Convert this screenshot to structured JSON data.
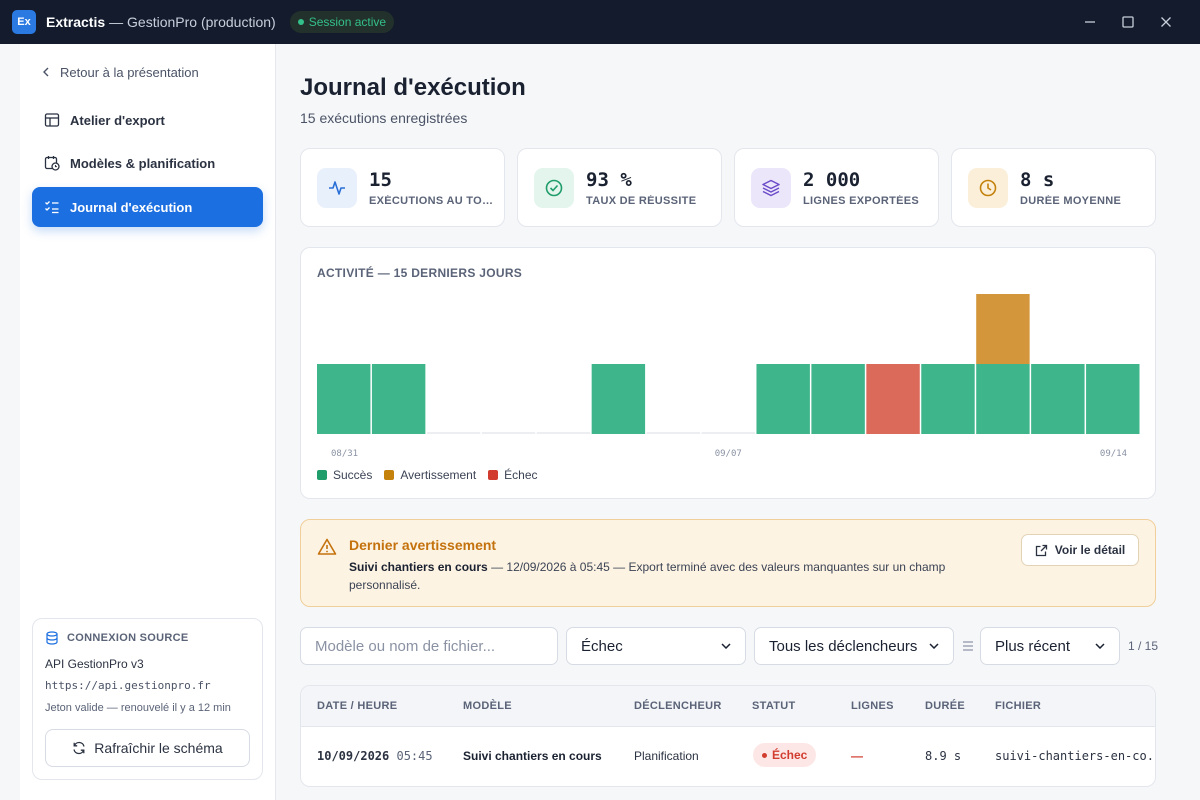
{
  "titlebar": {
    "app_name": "Extractis",
    "app_logo": "Ex",
    "app_context": "— GestionPro (production)",
    "session_badge": "Session active"
  },
  "sidebar": {
    "back_link": "Retour à la présentation",
    "items": [
      {
        "label": "Atelier d'export",
        "icon": "table-icon",
        "active": false
      },
      {
        "label": "Modèles & planification",
        "icon": "calendar-clock-icon",
        "active": false
      },
      {
        "label": "Journal d'exécution",
        "icon": "checklist-icon",
        "active": true
      }
    ],
    "connection": {
      "title": "CONNEXION SOURCE",
      "name": "API GestionPro v3",
      "url": "https://api.gestionpro.fr",
      "token": "Jeton valide — renouvelé il y a 12 min",
      "refresh_label": "Rafraîchir le schéma"
    }
  },
  "page": {
    "title": "Journal d'exécution",
    "subtitle": "15 exécutions enregistrées"
  },
  "stats": [
    {
      "value": "15",
      "label": "EXÉCUTIONS AU TOTAL",
      "icon": "activity-icon",
      "color": "#2a6fd6",
      "bg": "#e8f0fc"
    },
    {
      "value": "93 %",
      "label": "TAUX DE RÉUSSITE",
      "icon": "check-circle-icon",
      "color": "#1f9d6a",
      "bg": "#e3f5ec"
    },
    {
      "value": "2 000",
      "label": "LIGNES EXPORTÉES",
      "icon": "layers-icon",
      "color": "#6b4bc8",
      "bg": "#ece6fb"
    },
    {
      "value": "8 s",
      "label": "DURÉE MOYENNE",
      "icon": "clock-icon",
      "color": "#c4820d",
      "bg": "#fcefd9"
    }
  ],
  "chart_data": {
    "type": "bar",
    "title": "ACTIVITÉ — 15 DERNIERS JOURS",
    "categories": [
      "08/31",
      "09/01",
      "09/02",
      "09/03",
      "09/04",
      "09/05",
      "09/06",
      "09/07",
      "09/08",
      "09/09",
      "09/10",
      "09/11",
      "09/12",
      "09/13",
      "09/14"
    ],
    "tick_labels": [
      "08/31",
      "09/07",
      "09/14"
    ],
    "series": [
      {
        "name": "Succès",
        "color": "#3fb58b",
        "values": [
          1,
          1,
          0,
          0,
          0,
          1,
          0,
          0,
          1,
          1,
          0,
          1,
          1,
          1,
          1
        ]
      },
      {
        "name": "Avertissement",
        "color": "#d4963a",
        "values": [
          0,
          0,
          0,
          0,
          0,
          0,
          0,
          0,
          0,
          0,
          0,
          0,
          1,
          0,
          0
        ]
      },
      {
        "name": "Échec",
        "color": "#dc6a5a",
        "values": [
          0,
          0,
          0,
          0,
          0,
          0,
          0,
          0,
          0,
          0,
          1,
          0,
          0,
          0,
          0
        ]
      }
    ],
    "ylim": [
      0,
      2
    ],
    "stacked": true,
    "legend": "bottom-left",
    "legend_colors": [
      "#1f9d6a",
      "#c4820d",
      "#d13c2f"
    ]
  },
  "warning": {
    "title": "Dernier avertissement",
    "model": "Suivi chantiers en cours",
    "message": "— 12/09/2026 à 05:45 — Export terminé avec des valeurs manquantes sur un champ personnalisé.",
    "detail_label": "Voir le détail"
  },
  "filters": {
    "search_placeholder": "Modèle ou nom de fichier...",
    "status_value": "Échec",
    "trigger_value": "Tous les déclencheurs",
    "sort_value": "Plus récent",
    "page_count": "1 / 15"
  },
  "table": {
    "columns": [
      "DATE / HEURE",
      "MODÈLE",
      "DÉCLENCHEUR",
      "STATUT",
      "LIGNES",
      "DURÉE",
      "FICHIER"
    ],
    "rows": [
      {
        "date": "10/09/2026",
        "time": "05:45",
        "model": "Suivi chantiers en cours",
        "trigger": "Planification",
        "status": "Échec",
        "lines": "—",
        "duration": "8.9 s",
        "file": "suivi-chantiers-en-co..."
      }
    ]
  }
}
